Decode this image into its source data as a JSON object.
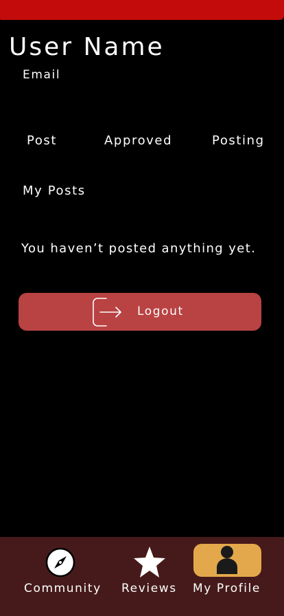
{
  "colors": {
    "top_bar": "#c30b0b",
    "background": "#000000",
    "logout_button": "#b94242",
    "bottom_nav": "#461a1a",
    "active_tab_highlight": "#e3a84b"
  },
  "profile": {
    "user_name": "User Name",
    "email": "Email"
  },
  "stats": {
    "post_label": "Post",
    "approved_label": "Approved",
    "posting_label": "Posting"
  },
  "posts": {
    "section_title": "My Posts",
    "empty_message": "You haven’t posted anything yet."
  },
  "logout": {
    "label": "Logout",
    "icon": "logout-icon"
  },
  "bottom_nav": {
    "items": [
      {
        "label": "Community",
        "icon": "compass-icon",
        "active": false
      },
      {
        "label": "Reviews",
        "icon": "star-icon",
        "active": false
      },
      {
        "label": "My Profile",
        "icon": "person-icon",
        "active": true
      }
    ]
  }
}
